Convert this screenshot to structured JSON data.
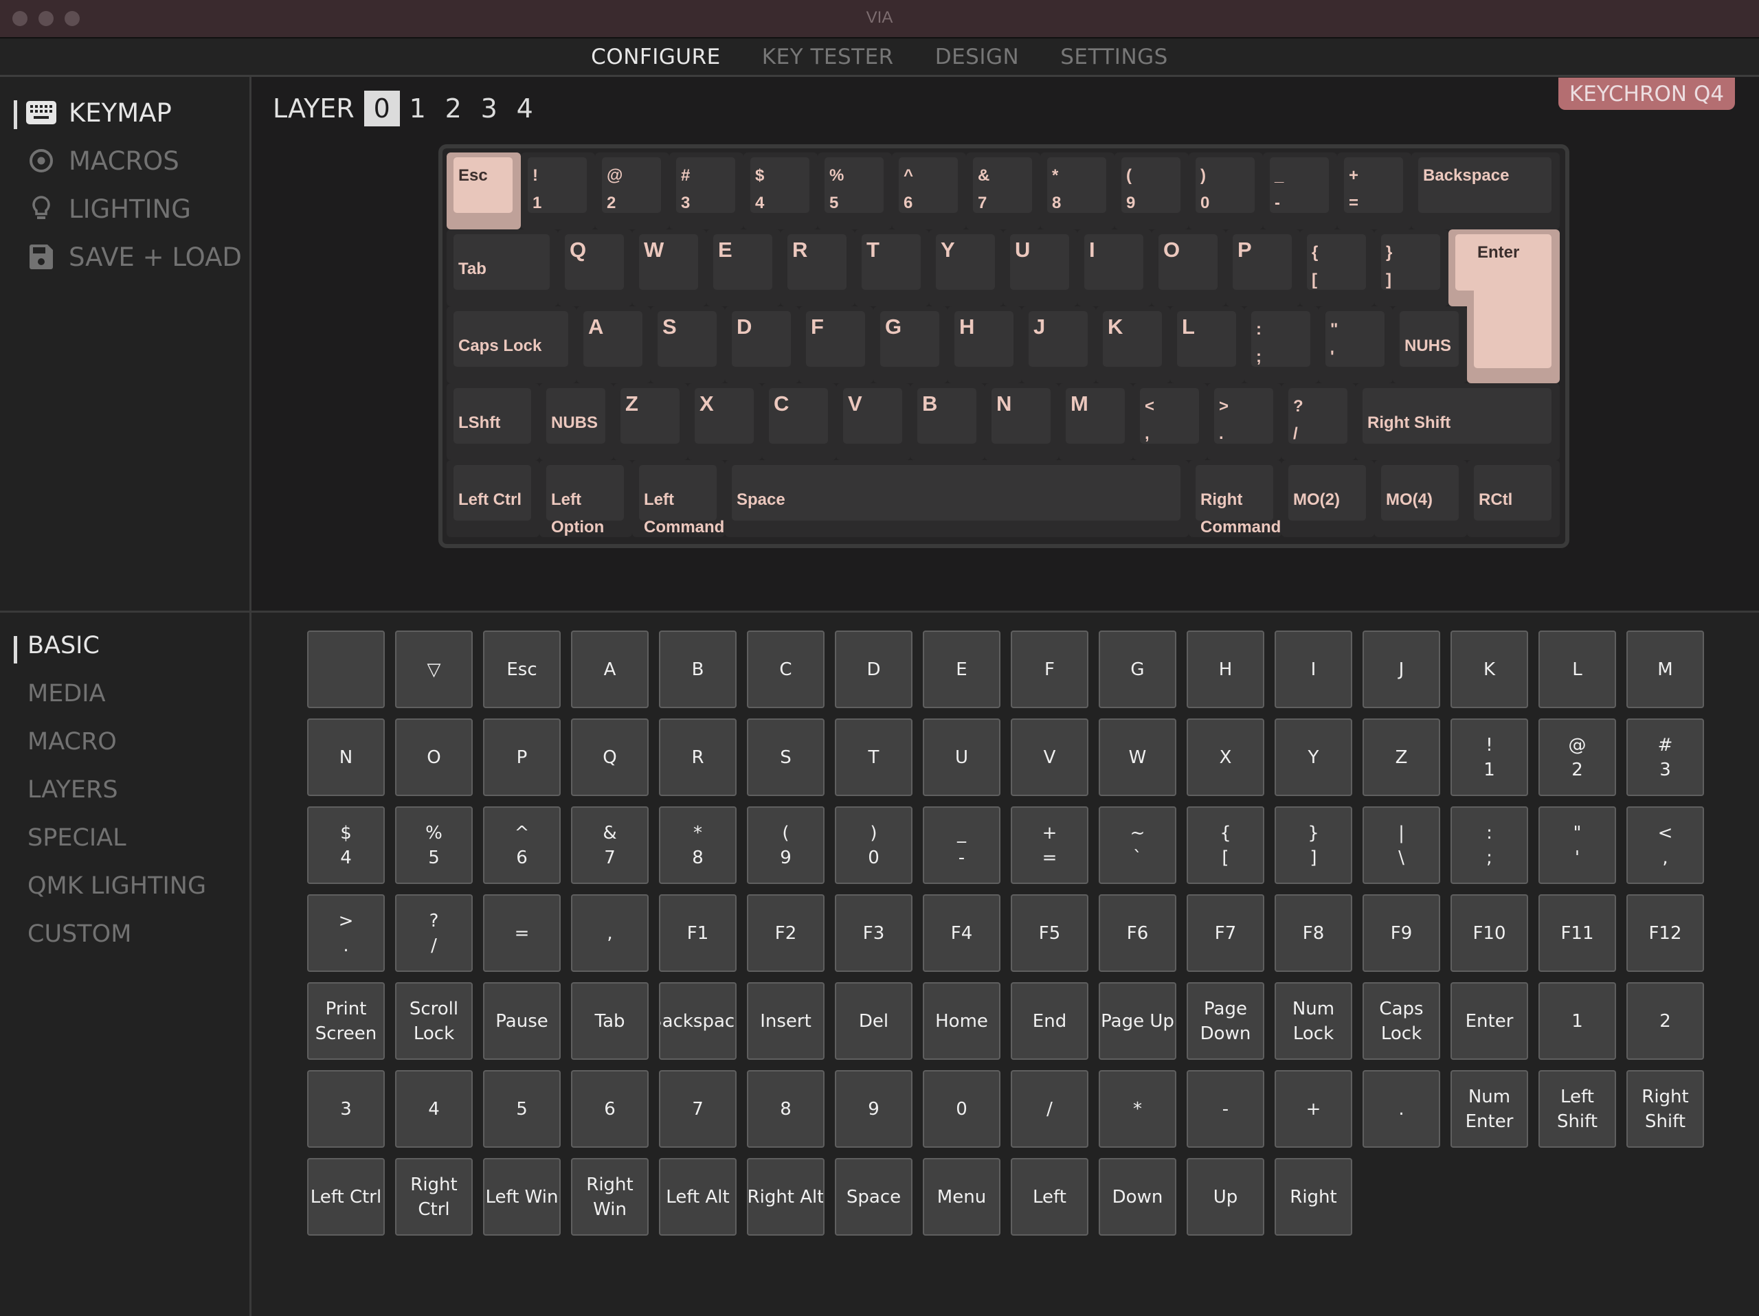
{
  "window": {
    "title": "VIA"
  },
  "nav": {
    "tabs": [
      {
        "label": "CONFIGURE",
        "active": true
      },
      {
        "label": "KEY TESTER",
        "active": false
      },
      {
        "label": "DESIGN",
        "active": false
      },
      {
        "label": "SETTINGS",
        "active": false
      }
    ]
  },
  "sidebar": {
    "items": [
      {
        "label": "KEYMAP",
        "icon": "keyboard-icon",
        "active": true
      },
      {
        "label": "MACROS",
        "icon": "record-icon",
        "active": false
      },
      {
        "label": "LIGHTING",
        "icon": "lightbulb-icon",
        "active": false
      },
      {
        "label": "SAVE + LOAD",
        "icon": "floppy-disk-icon",
        "active": false
      }
    ]
  },
  "layers": {
    "label": "LAYER",
    "options": [
      "0",
      "1",
      "2",
      "3",
      "4"
    ],
    "selected": "0"
  },
  "device": {
    "name": "KEYCHRON Q4"
  },
  "colors": {
    "accent": "#b46e71",
    "keycap_legend": "#ecc8be",
    "selected_keycap": "#e8c6bb",
    "titlebar": "#3a2a2e"
  },
  "keyboard": {
    "selected_key": "Esc",
    "rows": [
      [
        {
          "top": "Esc",
          "w": 1,
          "sel": true
        },
        {
          "top": "!",
          "bottom": "1",
          "w": 1
        },
        {
          "top": "@",
          "bottom": "2",
          "w": 1
        },
        {
          "top": "#",
          "bottom": "3",
          "w": 1
        },
        {
          "top": "$",
          "bottom": "4",
          "w": 1
        },
        {
          "top": "%",
          "bottom": "5",
          "w": 1
        },
        {
          "top": "^",
          "bottom": "6",
          "w": 1
        },
        {
          "top": "&",
          "bottom": "7",
          "w": 1
        },
        {
          "top": "*",
          "bottom": "8",
          "w": 1
        },
        {
          "top": "(",
          "bottom": "9",
          "w": 1
        },
        {
          "top": ")",
          "bottom": "0",
          "w": 1
        },
        {
          "top": "_",
          "bottom": "-",
          "w": 1
        },
        {
          "top": "+",
          "bottom": "=",
          "w": 1
        },
        {
          "top": "Backspace",
          "w": 2
        }
      ],
      [
        {
          "top": "Tab",
          "w": 1.5,
          "mid": true
        },
        {
          "top": "Q",
          "w": 1,
          "big": true
        },
        {
          "top": "W",
          "w": 1,
          "big": true
        },
        {
          "top": "E",
          "w": 1,
          "big": true
        },
        {
          "top": "R",
          "w": 1,
          "big": true
        },
        {
          "top": "T",
          "w": 1,
          "big": true
        },
        {
          "top": "Y",
          "w": 1,
          "big": true
        },
        {
          "top": "U",
          "w": 1,
          "big": true
        },
        {
          "top": "I",
          "w": 1,
          "big": true
        },
        {
          "top": "O",
          "w": 1,
          "big": true
        },
        {
          "top": "P",
          "w": 1,
          "big": true
        },
        {
          "top": "{",
          "bottom": "[",
          "w": 1
        },
        {
          "top": "}",
          "bottom": "]",
          "w": 1
        }
      ],
      [
        {
          "top": "Caps Lock",
          "w": 1.75,
          "mid": true
        },
        {
          "top": "A",
          "w": 1,
          "big": true
        },
        {
          "top": "S",
          "w": 1,
          "big": true
        },
        {
          "top": "D",
          "w": 1,
          "big": true
        },
        {
          "top": "F",
          "w": 1,
          "big": true
        },
        {
          "top": "G",
          "w": 1,
          "big": true
        },
        {
          "top": "H",
          "w": 1,
          "big": true
        },
        {
          "top": "J",
          "w": 1,
          "big": true
        },
        {
          "top": "K",
          "w": 1,
          "big": true
        },
        {
          "top": "L",
          "w": 1,
          "big": true
        },
        {
          "top": ":",
          "bottom": ";",
          "w": 1
        },
        {
          "top": "\"",
          "bottom": "'",
          "w": 1
        },
        {
          "top": "NUHS",
          "w": 1,
          "mid": true
        }
      ],
      [
        {
          "top": "LShft",
          "w": 1.25,
          "mid": true
        },
        {
          "top": "NUBS",
          "w": 1,
          "mid": true
        },
        {
          "top": "Z",
          "w": 1,
          "big": true
        },
        {
          "top": "X",
          "w": 1,
          "big": true
        },
        {
          "top": "C",
          "w": 1,
          "big": true
        },
        {
          "top": "V",
          "w": 1,
          "big": true
        },
        {
          "top": "B",
          "w": 1,
          "big": true
        },
        {
          "top": "N",
          "w": 1,
          "big": true
        },
        {
          "top": "M",
          "w": 1,
          "big": true
        },
        {
          "top": "<",
          "bottom": ",",
          "w": 1
        },
        {
          "top": ">",
          "bottom": ".",
          "w": 1
        },
        {
          "top": "?",
          "bottom": "/",
          "w": 1
        },
        {
          "top": "Right Shift",
          "w": 2.75,
          "mid": true
        }
      ],
      [
        {
          "top": "Left Ctrl",
          "w": 1.25,
          "mid": true
        },
        {
          "top": "Left",
          "bottom": "Option",
          "w": 1.25,
          "mid": true
        },
        {
          "top": "Left",
          "bottom": "Command",
          "w": 1.25,
          "mid": true
        },
        {
          "top": "Space",
          "w": 6.25,
          "mid": true
        },
        {
          "top": "Right",
          "bottom": "Command",
          "w": 1.25,
          "mid": true
        },
        {
          "top": "MO(2)",
          "w": 1.25,
          "mid": true
        },
        {
          "top": "MO(4)",
          "w": 1.25,
          "mid": true
        },
        {
          "top": "RCtl",
          "w": 1.25,
          "mid": true
        }
      ]
    ],
    "enter": {
      "top": "Enter"
    }
  },
  "categories": {
    "items": [
      {
        "label": "BASIC",
        "active": true
      },
      {
        "label": "MEDIA",
        "active": false
      },
      {
        "label": "MACRO",
        "active": false
      },
      {
        "label": "LAYERS",
        "active": false
      },
      {
        "label": "SPECIAL",
        "active": false
      },
      {
        "label": "QMK LIGHTING",
        "active": false
      },
      {
        "label": "CUSTOM",
        "active": false
      }
    ]
  },
  "picker": {
    "rows": [
      [
        [
          ""
        ],
        [
          "▽"
        ],
        [
          "Esc"
        ],
        [
          "A"
        ],
        [
          "B"
        ],
        [
          "C"
        ],
        [
          "D"
        ],
        [
          "E"
        ],
        [
          "F"
        ],
        [
          "G"
        ],
        [
          "H"
        ],
        [
          "I"
        ],
        [
          "J"
        ],
        [
          "K"
        ],
        [
          "L"
        ],
        [
          "M"
        ]
      ],
      [
        [
          "N"
        ],
        [
          "O"
        ],
        [
          "P"
        ],
        [
          "Q"
        ],
        [
          "R"
        ],
        [
          "S"
        ],
        [
          "T"
        ],
        [
          "U"
        ],
        [
          "V"
        ],
        [
          "W"
        ],
        [
          "X"
        ],
        [
          "Y"
        ],
        [
          "Z"
        ],
        [
          "!",
          "1"
        ],
        [
          "@",
          "2"
        ],
        [
          "#",
          "3"
        ]
      ],
      [
        [
          "$",
          "4"
        ],
        [
          "%",
          "5"
        ],
        [
          "^",
          "6"
        ],
        [
          "&",
          "7"
        ],
        [
          "*",
          "8"
        ],
        [
          "(",
          "9"
        ],
        [
          ")",
          "0"
        ],
        [
          "_",
          "-"
        ],
        [
          "+",
          "="
        ],
        [
          "~",
          "`"
        ],
        [
          "{",
          "["
        ],
        [
          "}",
          "]"
        ],
        [
          "|",
          "\\"
        ],
        [
          ":",
          ";"
        ],
        [
          "\"",
          "'"
        ],
        [
          "<",
          ","
        ]
      ],
      [
        [
          ">",
          "."
        ],
        [
          "?",
          "/"
        ],
        [
          "="
        ],
        [
          ","
        ],
        [
          "F1"
        ],
        [
          "F2"
        ],
        [
          "F3"
        ],
        [
          "F4"
        ],
        [
          "F5"
        ],
        [
          "F6"
        ],
        [
          "F7"
        ],
        [
          "F8"
        ],
        [
          "F9"
        ],
        [
          "F10"
        ],
        [
          "F11"
        ],
        [
          "F12"
        ]
      ],
      [
        [
          "Print",
          "Screen"
        ],
        [
          "Scroll",
          "Lock"
        ],
        [
          "Pause"
        ],
        [
          "Tab"
        ],
        [
          "Backspace"
        ],
        [
          "Insert"
        ],
        [
          "Del"
        ],
        [
          "Home"
        ],
        [
          "End"
        ],
        [
          "Page Up"
        ],
        [
          "Page",
          "Down"
        ],
        [
          "Num",
          "Lock"
        ],
        [
          "Caps",
          "Lock"
        ],
        [
          "Enter"
        ],
        [
          "1"
        ],
        [
          "2"
        ]
      ],
      [
        [
          "3"
        ],
        [
          "4"
        ],
        [
          "5"
        ],
        [
          "6"
        ],
        [
          "7"
        ],
        [
          "8"
        ],
        [
          "9"
        ],
        [
          "0"
        ],
        [
          "/"
        ],
        [
          "*"
        ],
        [
          "-"
        ],
        [
          "+"
        ],
        [
          "."
        ],
        [
          "Num",
          "Enter"
        ],
        [
          "Left",
          "Shift"
        ],
        [
          "Right",
          "Shift"
        ]
      ],
      [
        [
          "Left Ctrl"
        ],
        [
          "Right",
          "Ctrl"
        ],
        [
          "Left Win"
        ],
        [
          "Right",
          "Win"
        ],
        [
          "Left Alt"
        ],
        [
          "Right Alt"
        ],
        [
          "Space"
        ],
        [
          "Menu"
        ],
        [
          "Left"
        ],
        [
          "Down"
        ],
        [
          "Up"
        ],
        [
          "Right"
        ]
      ]
    ]
  }
}
